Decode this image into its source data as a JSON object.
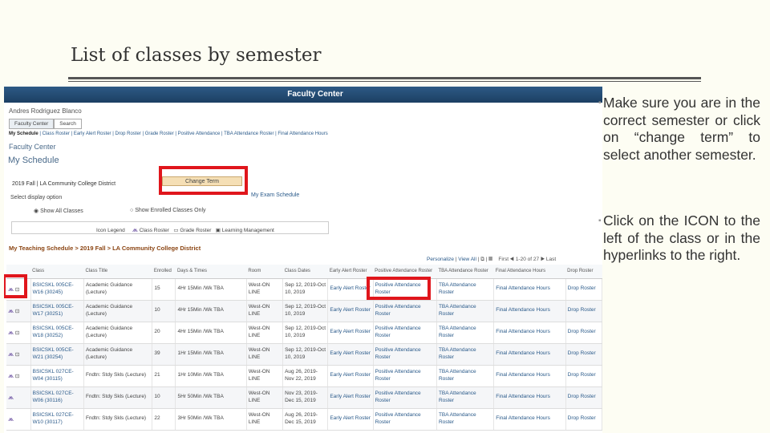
{
  "slide": {
    "title": "List of classes by semester",
    "bullets": [
      "Make sure you are in the correct semester or click on “change term” to select another semester.",
      "Click on the ICON to the left of the class or in the hyperlinks to the right."
    ]
  },
  "app": {
    "banner": "Faculty Center",
    "user": "Andres Rodriguez Blanco",
    "tabs": [
      "Faculty Center",
      "Search"
    ],
    "nav": [
      "My Schedule",
      "Class Roster",
      "Early Alert Roster",
      "Drop Roster",
      "Grade Roster",
      "Positive Attendance",
      "TBA Attendance Roster",
      "Final Attendance Hours"
    ],
    "heading": "Faculty Center",
    "page_title": "My Schedule",
    "term": "2019 Fall | LA Community College District",
    "change_term": "Change Term",
    "exam_schedule": "My Exam Schedule",
    "display_option": "Select display option",
    "opt_all": "Show All Classes",
    "opt_enrolled": "Show Enrolled Classes Only",
    "legend": {
      "label": "Icon Legend",
      "class_roster": "Class Roster",
      "grade_roster": "Grade Roster",
      "lms": "Learning Management"
    },
    "breadcrumb": "My Teaching Schedule > 2019 Fall > LA Community College District",
    "grid_nav": {
      "personalize": "Personalize",
      "view_all": "View All",
      "first": "First",
      "range": "1-20 of 27",
      "last": "Last"
    },
    "columns": [
      "Class",
      "Class Title",
      "Enrolled",
      "Days & Times",
      "Room",
      "Class Dates",
      "Early Alert Roster",
      "Positive Attendance Roster",
      "TBA Attendance Roster",
      "Final Attendance Hours",
      "Drop Roster"
    ],
    "rows": [
      [
        "BSICSKL 005CE-W16 (30245)",
        "Academic Guidance (Lecture)",
        "15",
        "4Hr 15Min /Wk TBA",
        "West-ON LINE",
        "Sep 12, 2019-Oct 10, 2019"
      ],
      [
        "BSICSKL 005CE-W17 (30251)",
        "Academic Guidance (Lecture)",
        "10",
        "4Hr 15Min /Wk TBA",
        "West-ON LINE",
        "Sep 12, 2019-Oct 10, 2019"
      ],
      [
        "BSICSKL 005CE-W18 (30252)",
        "Academic Guidance (Lecture)",
        "20",
        "4Hr 15Min /Wk TBA",
        "West-ON LINE",
        "Sep 12, 2019-Oct 10, 2019"
      ],
      [
        "BSICSKL 005CE-W21 (30254)",
        "Academic Guidance (Lecture)",
        "39",
        "1Hr 15Min /Wk TBA",
        "West-ON LINE",
        "Sep 12, 2019-Oct 10, 2019"
      ],
      [
        "BSICSKL 027CE-W04 (30115)",
        "Fndtn: Stdy Skls (Lecture)",
        "21",
        "1Hr 10Min /Wk TBA",
        "West-ON LINE",
        "Aug 26, 2019-Nov 22, 2019"
      ],
      [
        "BSICSKL 027CE-W06 (30116)",
        "Fndtn: Stdy Skls (Lecture)",
        "10",
        "5Hr 50Min /Wk TBA",
        "West-ON LINE",
        "Nov 23, 2019-Dec 15, 2019"
      ],
      [
        "BSICSKL 027CE-W10 (30117)",
        "Fndtn: Stdy Skls (Lecture)",
        "22",
        "3Hr 50Min /Wk TBA",
        "West-ON LINE",
        "Aug 26, 2019-Dec 15, 2019"
      ]
    ],
    "links": [
      "Early Alert Roster",
      "Positive Attendance Roster",
      "TBA Attendance Roster",
      "Final Attendance Hours",
      "Drop Roster"
    ]
  },
  "colors": {
    "banner": "#1c3f63",
    "highlight": "#e0161c"
  }
}
